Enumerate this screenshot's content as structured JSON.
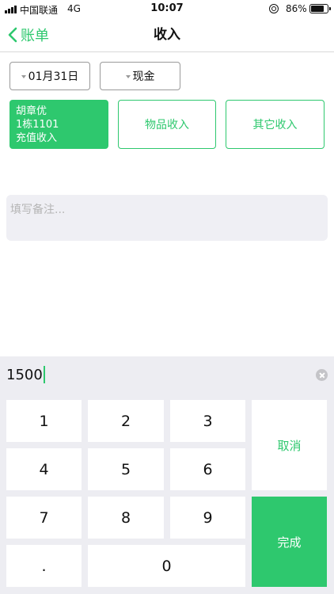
{
  "status_bar": {
    "carrier": "中国联通",
    "network": "4G",
    "time": "10:07",
    "battery_percent": "86%",
    "battery_level": 0.86
  },
  "nav": {
    "back_label": "账单",
    "title": "收入"
  },
  "filters": {
    "date": "01月31日",
    "payment_method": "现金"
  },
  "categories": {
    "resident": {
      "name": "胡章优",
      "room": "1栋1101",
      "type": "充值收入",
      "selected": true
    },
    "goods": "物品收入",
    "other": "其它收入"
  },
  "remark": {
    "placeholder": "填写备注...",
    "value": ""
  },
  "amount": {
    "value": "1500"
  },
  "keypad": {
    "keys": [
      "1",
      "2",
      "3",
      "4",
      "5",
      "6",
      "7",
      "8",
      "9",
      ".",
      "0"
    ],
    "cancel": "取消",
    "done": "完成"
  },
  "colors": {
    "accent": "#2ec86e",
    "keypad_background": "#ededf2",
    "remark_background": "#efeff4"
  },
  "icons": [
    "signal-icon",
    "location-lock-icon",
    "battery-icon",
    "back-chevron-icon",
    "dropdown-caret-icon",
    "clear-icon"
  ]
}
